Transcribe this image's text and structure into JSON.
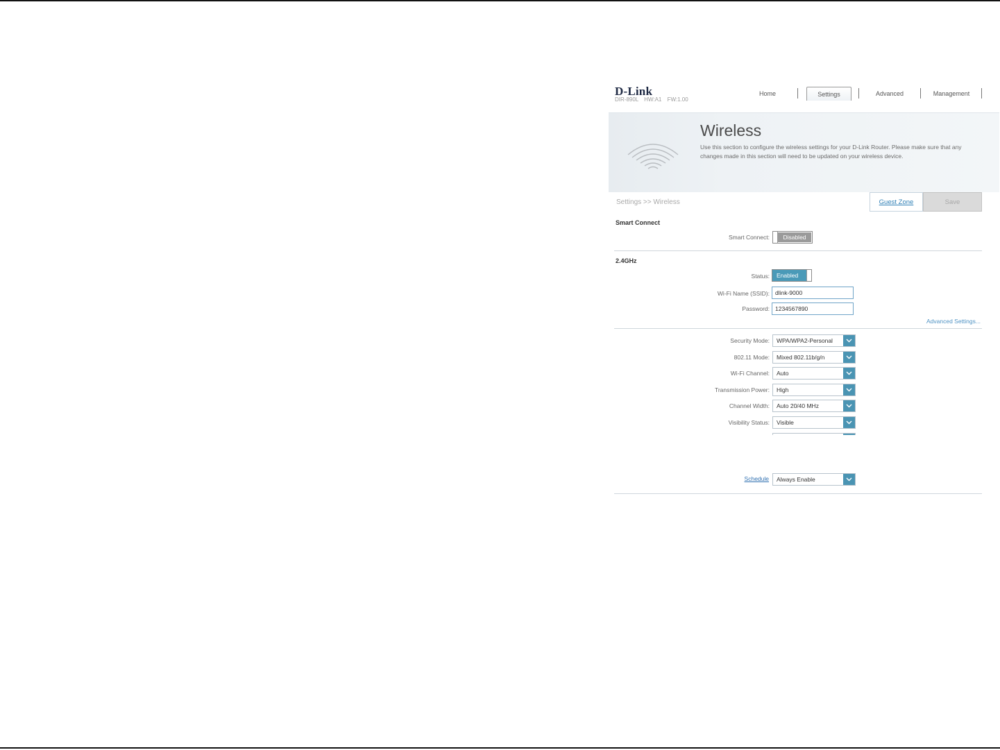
{
  "header": {
    "brand": "D-Link",
    "subtitle": "DIR-890L   HW:A1   FW:1.00"
  },
  "nav": {
    "home": "Home",
    "settings": "Settings",
    "advanced": "Advanced",
    "management": "Management",
    "active": "Settings"
  },
  "banner": {
    "title": "Wireless",
    "description": "Use this section to configure the wireless settings for your D-Link Router. Please make sure that any changes made in this section will need to be updated on your wireless device."
  },
  "breadcrumb": "Settings >> Wireless",
  "buttons": {
    "guest_zone": "Guest Zone",
    "save": "Save"
  },
  "smart_connect": {
    "section_title": "Smart Connect",
    "label": "Smart Connect:",
    "value": "Disabled"
  },
  "band_24": {
    "section_title": "2.4GHz",
    "status_label": "Status:",
    "status_value": "Enabled",
    "ssid_label": "Wi-Fi Name (SSID):",
    "ssid_value": "dlink-9000",
    "password_label": "Password:",
    "password_value": "1234567890",
    "advanced_link": "Advanced Settings...",
    "security_mode_label": "Security Mode:",
    "security_mode_value": "WPA/WPA2-Personal",
    "mode_80211_label": "802.11 Mode:",
    "mode_80211_value": "Mixed 802.11b/g/n",
    "channel_label": "Wi-Fi Channel:",
    "channel_value": "Auto",
    "power_label": "Transmission Power:",
    "power_value": "High",
    "width_label": "Channel Width:",
    "width_value": "Auto 20/40 MHz",
    "visibility_label": "Visibility Status:",
    "visibility_value": "Visible",
    "schedule_link": "Schedule",
    "schedule_value": "Always Enable"
  },
  "colors": {
    "accent_blue": "#4a94b3",
    "link_blue": "#2e7fb5",
    "disabled_gray": "#9a9a9a"
  }
}
